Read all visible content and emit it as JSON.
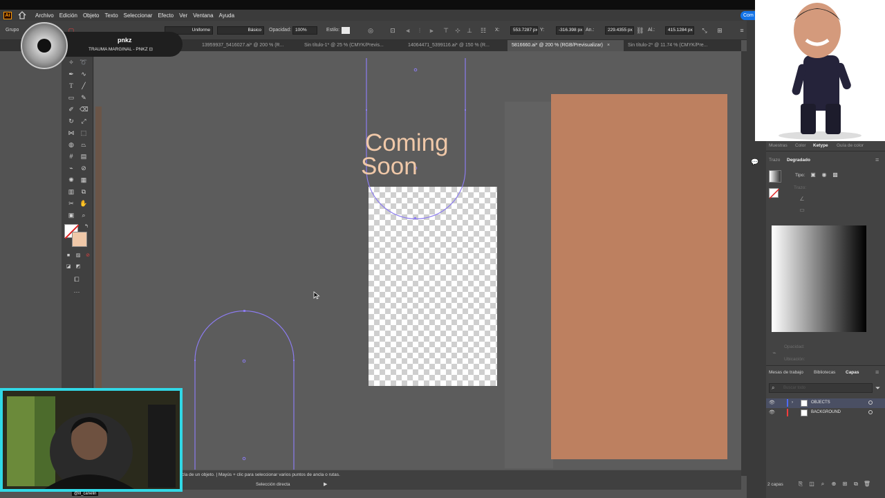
{
  "app": {
    "logo": "Ai",
    "menu": [
      "Archivo",
      "Edición",
      "Objeto",
      "Texto",
      "Seleccionar",
      "Efecto",
      "Ver",
      "Ventana",
      "Ayuda"
    ],
    "share_label": "Com"
  },
  "controlbar": {
    "group_label": "Grupo",
    "stroke_profile": "Uniforme",
    "brush": "Básico",
    "opacity_label": "Opacidad:",
    "opacity_value": "100%",
    "style_label": "Estilo:",
    "x_label": "X:",
    "x_value": "553.7287 px",
    "y_label": "Y:",
    "y_value": "-316.398 px",
    "w_label": "An.:",
    "w_value": "229.4355 px",
    "h_label": "Al.:",
    "h_value": "415.1284 px"
  },
  "tabs": [
    {
      "label": "13959937_5416027.ai* @ 200 % (R..."
    },
    {
      "label": "Sin título-1* @ 25 % (CMYK/Previs..."
    },
    {
      "label": "14064471_5399116.ai* @ 150 % (R..."
    },
    {
      "label": "5816660.ai* @ 200 % (RGB/Previsualizar)"
    },
    {
      "label": "Sin título-2* @ 11.74 % (CMYK/Pre..."
    }
  ],
  "canvas": {
    "headline_line1": "Coming",
    "headline_line2": "Soon",
    "colors": {
      "orange_artboard": "#bd8060",
      "headline": "#f0c8a8",
      "path_outline": "#8c7cf0"
    }
  },
  "status": {
    "hint": "cla de un objeto.  |  Mayús + clic para seleccionar varios puntos de ancla o rutas.",
    "tool": "Selección directa"
  },
  "panels": {
    "top_tabs": [
      "Muestras",
      "Color",
      "Ketype",
      "Guía de color"
    ],
    "trazo_label": "Trazo",
    "degradado_label": "Degradado",
    "tipo_label": "Tipo:",
    "trazo2_label": "Trazo:",
    "opacidad_label": "Opacidad:",
    "ubicacion_label": "Ubicación:",
    "bottom_tabs": [
      "Mesas de trabajo",
      "Bibliotecas",
      "Capas"
    ],
    "search_placeholder": "Buscar todo",
    "layers": [
      {
        "name": "OBJECTS",
        "color": "#4e6bff"
      },
      {
        "name": "BACKGROUND",
        "color": "#ff3b3b"
      }
    ],
    "layer_count": "2 capas"
  },
  "overlays": {
    "channel_name": "pnkz",
    "channel_sub": "TRAUMA MARGINAL - PNKZ ⊡",
    "webcam_handle": "@ill_canelin"
  }
}
